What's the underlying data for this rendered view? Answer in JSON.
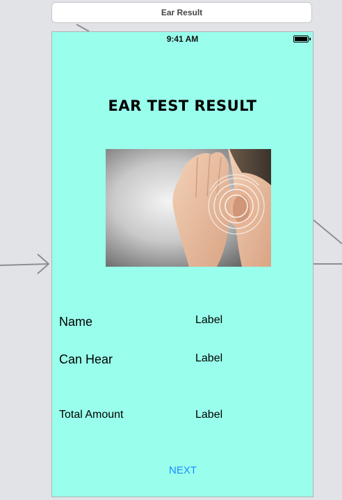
{
  "scene": {
    "title": "Ear Result"
  },
  "status_bar": {
    "time": "9:41 AM",
    "battery_icon": "battery-full-icon"
  },
  "page": {
    "title": "EAR TEST RESULT",
    "image": "ear-listening-image"
  },
  "rows": {
    "name": {
      "label": "Name",
      "value": "Label"
    },
    "can_hear": {
      "label": "Can Hear",
      "value": "Label"
    },
    "total_amount": {
      "label": "Total Amount",
      "value": "Label"
    }
  },
  "actions": {
    "next_label": "NEXT"
  },
  "colors": {
    "canvas_background": "#e2e3e6",
    "screen_background": "#99ffec",
    "button_tint": "#1a8cff"
  }
}
